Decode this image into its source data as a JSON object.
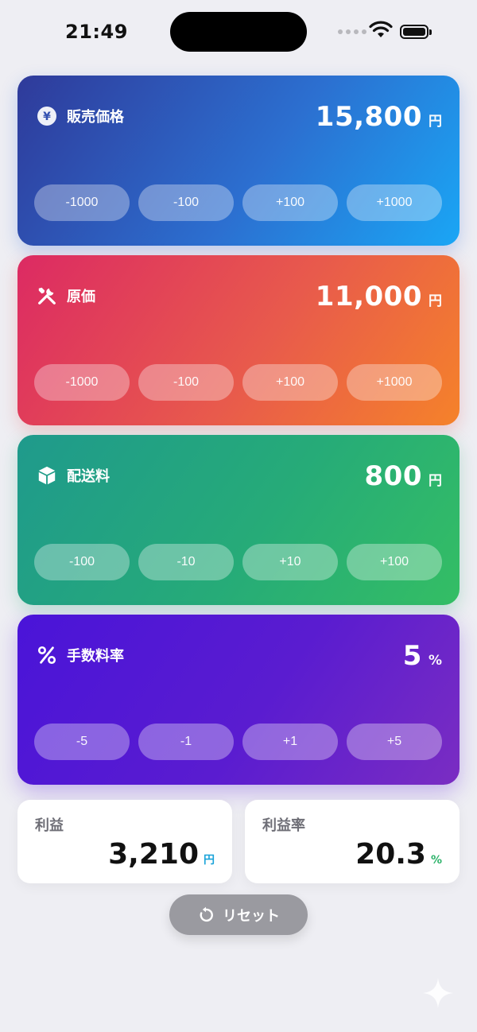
{
  "status": {
    "time": "21:49"
  },
  "cards": [
    {
      "key": "price",
      "label": "販売価格",
      "icon": "yen-circle-icon",
      "value": "15,800",
      "unit": "円",
      "buttons": [
        "-1000",
        "-100",
        "+100",
        "+1000"
      ]
    },
    {
      "key": "cost",
      "label": "原価",
      "icon": "tools-icon",
      "value": "11,000",
      "unit": "円",
      "buttons": [
        "-1000",
        "-100",
        "+100",
        "+1000"
      ]
    },
    {
      "key": "shipping",
      "label": "配送料",
      "icon": "box-icon",
      "value": "800",
      "unit": "円",
      "buttons": [
        "-100",
        "-10",
        "+10",
        "+100"
      ]
    },
    {
      "key": "fee_rate",
      "label": "手数料率",
      "icon": "percent-icon",
      "value": "5",
      "unit": "%",
      "buttons": [
        "-5",
        "-1",
        "+1",
        "+5"
      ]
    }
  ],
  "results": {
    "profit": {
      "label": "利益",
      "value": "3,210",
      "unit": "円"
    },
    "margin": {
      "label": "利益率",
      "value": "20.3",
      "unit": "%"
    }
  },
  "reset": {
    "label": "リセット",
    "icon": "reset-icon"
  },
  "colors": {
    "price_gradient": [
      "#2f3a9a",
      "#1aa6f5"
    ],
    "cost_gradient": [
      "#dc2a63",
      "#f5822a"
    ],
    "shipping_gradient": [
      "#1f9a8c",
      "#34be64"
    ],
    "fee_gradient": [
      "#4a14d8",
      "#7a2dc2"
    ],
    "profit_unit": "#1aa3d9",
    "margin_unit": "#2db36a"
  }
}
